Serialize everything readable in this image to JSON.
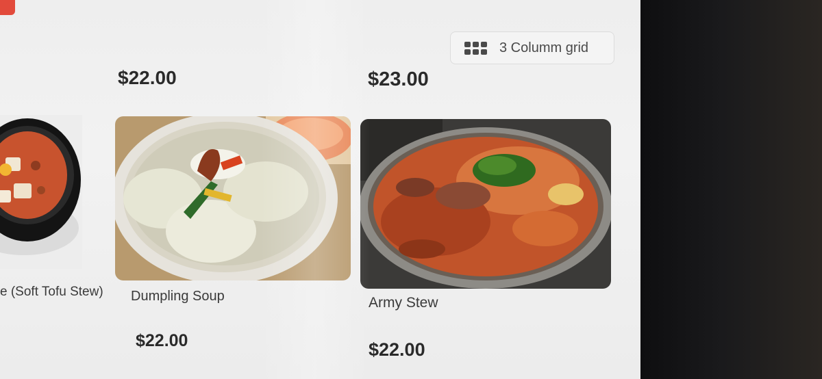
{
  "toolbar": {
    "grid_label": "3 Columm grid",
    "grid_icon": "grid-icon"
  },
  "top_prices": [
    "$22.00",
    "$23.00"
  ],
  "items": [
    {
      "name": "e (Soft Tofu Stew)",
      "price": ""
    },
    {
      "name": "Dumpling Soup",
      "price": "$22.00"
    },
    {
      "name": "Army Stew",
      "price": "$22.00"
    }
  ],
  "colors": {
    "accent": "#e24a3b"
  }
}
